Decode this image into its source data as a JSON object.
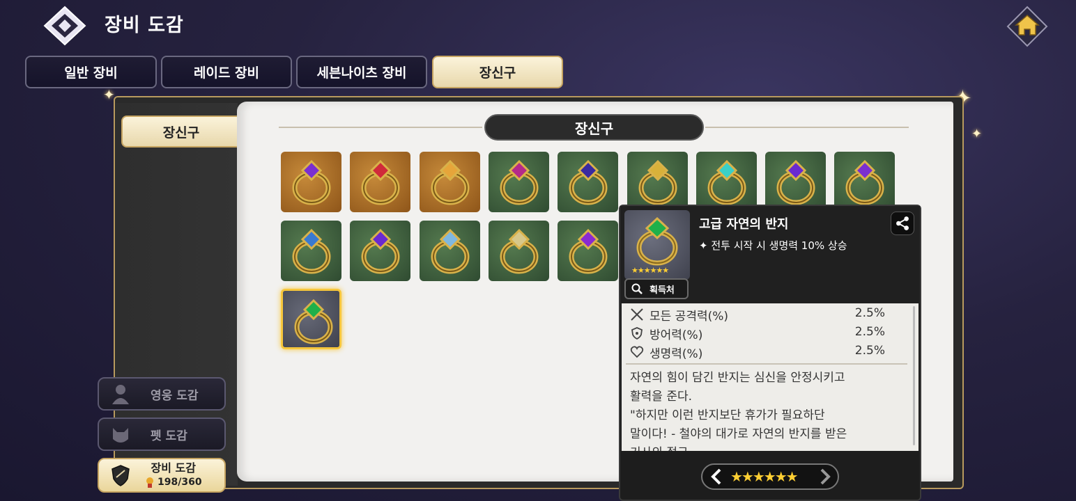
{
  "header": {
    "title": "장비 도감"
  },
  "tabs": [
    {
      "label": "일반 장비",
      "active": false
    },
    {
      "label": "레이드 장비",
      "active": false
    },
    {
      "label": "세븐나이츠 장비",
      "active": false
    },
    {
      "label": "장신구",
      "active": true
    }
  ],
  "category_tab": "장신구",
  "section_title": "장신구",
  "grid": {
    "items": [
      {
        "bg": "orange",
        "gem": "#7a2fd0"
      },
      {
        "bg": "orange",
        "gem": "#d02a3a"
      },
      {
        "bg": "orange",
        "gem": "#e6a53a"
      },
      {
        "bg": "green",
        "gem": "#b42a8a"
      },
      {
        "bg": "green",
        "gem": "#3a2aa0"
      },
      {
        "bg": "green",
        "gem": "#d8b13a"
      },
      {
        "bg": "green",
        "gem": "#3ad0c8"
      },
      {
        "bg": "green",
        "gem": "#6a2ad0"
      },
      {
        "bg": "green",
        "gem": "#7a2fd0"
      },
      {
        "bg": "green",
        "gem": "#3a7ad0"
      },
      {
        "bg": "green",
        "gem": "#6a2ad0"
      },
      {
        "bg": "green",
        "gem": "#7fb8e0"
      },
      {
        "bg": "green",
        "gem": "#d8c88a"
      },
      {
        "bg": "green",
        "gem": "#8a2ad0"
      },
      {
        "bg": "gray",
        "gem": "#2ab0e0"
      },
      {
        "bg": "gray",
        "gem": "#e67a1a"
      },
      {
        "bg": "gray",
        "gem": "#1a3ad0"
      },
      {
        "bg": "gray",
        "gem": "#d8b13a"
      },
      {
        "bg": "gray",
        "gem": "#1fb04a",
        "selected": true
      }
    ]
  },
  "side_nav": [
    {
      "label": "영웅 도감",
      "icon": "hero-icon",
      "active": false
    },
    {
      "label": "펫 도감",
      "icon": "pet-icon",
      "active": false
    },
    {
      "label": "장비 도감",
      "icon": "equipment-shield-icon",
      "active": true,
      "progress": "198/360"
    }
  ],
  "detail": {
    "name": "고급 자연의 반지",
    "effect": "✦ 전투 시작 시 생명력 10% 상승",
    "thumb_stars": "★★★★★★",
    "source_label": "획득처",
    "stats": [
      {
        "icon": "attack-swords-icon",
        "name": "모든 공격력(%)",
        "value": "2.5%"
      },
      {
        "icon": "defense-shield-icon",
        "name": "방어력(%)",
        "value": "2.5%"
      },
      {
        "icon": "heart-icon",
        "name": "생명력(%)",
        "value": "2.5%"
      }
    ],
    "description": [
      "자연의 힘이 담긴 반지는 심신을 안정시키고",
      "활력을 준다.",
      "\"하지만 이런 반지보단 휴가가 필요하단",
      "말이다! - 철야의 대가로 자연의 반지를 받은",
      "기사의 절규"
    ],
    "grade_stars": "★★★★★★"
  },
  "colors": {
    "gold": "#c6a461",
    "star": "#ffcf33",
    "selected": "#f6c63c"
  }
}
